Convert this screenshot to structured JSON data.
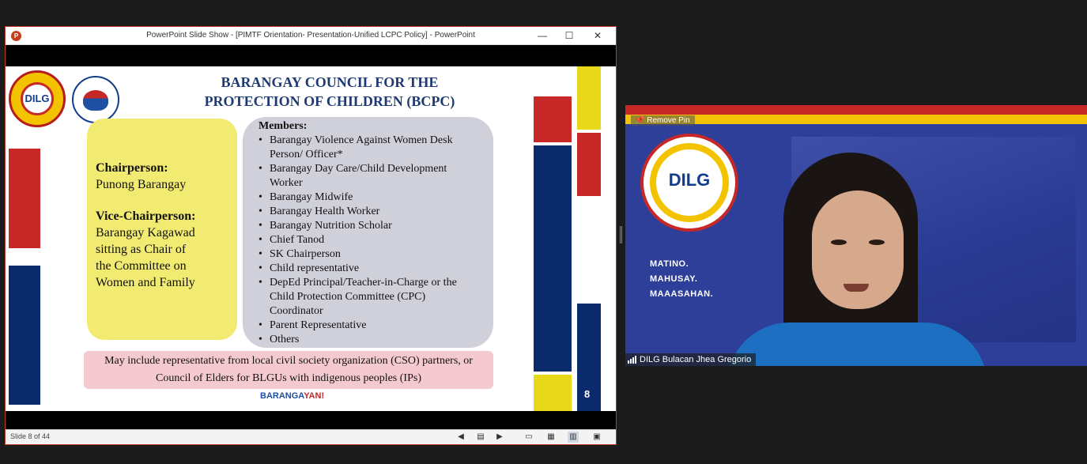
{
  "ppt_window": {
    "title": "PowerPoint Slide Show - [PIMTF Orientation- Presentation-Unified LCPC Policy] - PowerPoint",
    "app_icon": "P",
    "controls": {
      "minimize": "—",
      "maximize": "☐",
      "close": "✕"
    }
  },
  "slide": {
    "logo_dilg": "DILG",
    "title_line1": "BARANGAY COUNCIL FOR THE",
    "title_line2": "PROTECTION OF CHILDREN (BCPC)",
    "chairperson_label": "Chairperson:",
    "chairperson_value": "Punong Barangay",
    "vice_label": "Vice-Chairperson:",
    "vice_value_lines": [
      "Barangay Kagawad",
      "sitting as Chair of",
      "the Committee on",
      "Women and Family"
    ],
    "members_heading": "Members:",
    "members": [
      "Barangay Violence Against Women Desk Person/ Officer*",
      "Barangay Day Care/Child Development Worker",
      "Barangay Midwife",
      "Barangay Health Worker",
      "Barangay Nutrition Scholar",
      "Chief Tanod",
      "SK Chairperson",
      "Child representative",
      "DepEd Principal/Teacher-in-Charge or the Child Protection Committee (CPC) Coordinator",
      "Parent Representative",
      "Others"
    ],
    "note_line1": "May include representative from local civil society organization (CSO) partners, or",
    "note_line2": "Council of Elders for BLGUs with indigenous peoples (IPs)",
    "footer_brand_a": "BARANGA",
    "footer_brand_b": "YAN!",
    "slide_number": "8"
  },
  "status_bar": {
    "slide_info": "Slide 8 of 44",
    "icons": [
      "prev-icon",
      "notes-icon",
      "next-icon",
      "normal-view-icon",
      "slide-sorter-icon",
      "reading-view-icon",
      "slideshow-icon"
    ]
  },
  "video": {
    "remove_pin": "Remove Pin",
    "logo_text": "DILG",
    "motto": [
      "MATINO.",
      "MAHUSAY.",
      "MAAASAHAN."
    ],
    "participant_name": "DILG Bulacan Jhea Gregorio"
  },
  "colors": {
    "title_blue": "#1f3a73",
    "yellow_box": "#f2eb72",
    "gray_box": "#cfd0d9",
    "pink_box": "#f4c9cf",
    "red": "#c62828",
    "blue": "#0a2a6b",
    "yellow": "#e8d81a"
  }
}
